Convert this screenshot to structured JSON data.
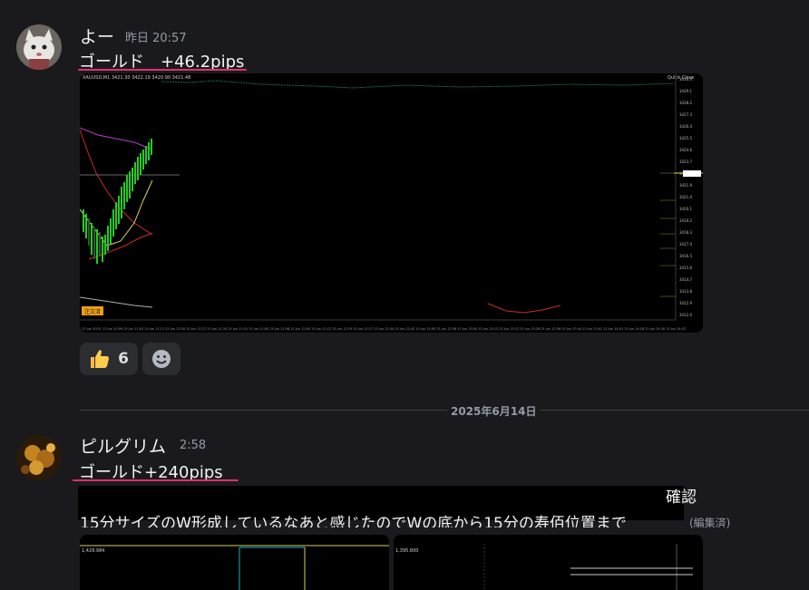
{
  "messages": [
    {
      "username": "よー",
      "timestamp": "昨日 20:57",
      "content": "ゴールド　+46.2pips",
      "reactions": [
        {
          "icon": "thumbs-up-icon",
          "count": "6"
        },
        {
          "icon": "add-reaction-icon",
          "count": ""
        }
      ]
    },
    {
      "username": "ピルグリム",
      "timestamp": "2:58",
      "content": "ゴールド+240pips",
      "tail_visible_end": "確認",
      "second_line_visible": "15分サイズのW形成しているなあと感じたのでWの底から15分の寿佰位置まで",
      "edited_label": "(編集済)"
    }
  ],
  "date_divider": "2025年6月14日",
  "chart_1": {
    "symbol_header": "XAUUSD,M1  3421.30 3422.19 3420.90 3421.48",
    "badge": "Quick Close",
    "price_tags": [
      "3430.4",
      "3429.1",
      "3428.2",
      "3427.3",
      "3426.4",
      "3425.5",
      "3424.6",
      "3423.7",
      "3422.8",
      "3421.9",
      "3421.0",
      "3420.1",
      "3419.2",
      "3418.3",
      "3417.4",
      "3416.5",
      "3415.6",
      "3414.7",
      "3413.8",
      "3412.9",
      "3412.0"
    ],
    "bottom_tag": "注文済",
    "time_labels": [
      "13 Jun 2025",
      "13 Jun 10:59",
      "13 Jun 11:03",
      "13 Jun 11:11",
      "13 Jun 11:20",
      "13 Jun 11:27",
      "13 Jun 11:34",
      "13 Jun 11:41",
      "13 Jun 11:50",
      "13 Jun 11:58",
      "13 Jun 12:05",
      "13 Jun 12:12",
      "13 Jun 12:19",
      "13 Jun 12:27",
      "13 Jun 12:34",
      "13 Jun 12:42",
      "13 Jun 12:50",
      "13 Jun 12:58",
      "13 Jun 13:05",
      "13 Jun 13:13",
      "13 Jun 13:21",
      "13 Jun 13:28",
      "13 Jun 13:36",
      "13 Jun 13:44",
      "13 Jun 13:51",
      "13 Jun 14:01",
      "13 Jun 14:18",
      "13 Jun 14:30",
      "13 Jun 14:47"
    ]
  },
  "chart_2a": {
    "label": "1,429.984"
  },
  "chart_2b": {
    "label": "1,395.800"
  },
  "colors": {
    "background": "#1a1a1e",
    "underline": "#e0306e",
    "bull_candle": "#22cc22",
    "bear_candle": "#cc2222",
    "ma_magenta": "#b83cc0",
    "ma_yellow": "#d8d060",
    "ma_red": "#cc2a2a"
  }
}
